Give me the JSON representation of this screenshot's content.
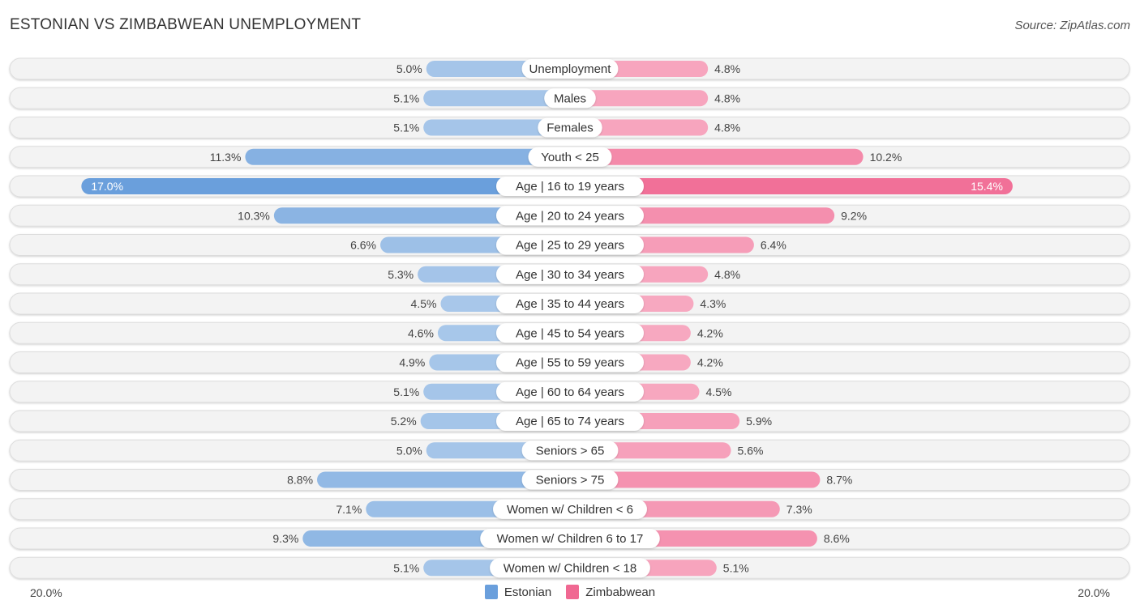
{
  "header": {
    "title": "ESTONIAN VS ZIMBABWEAN UNEMPLOYMENT",
    "source": "Source: ZipAtlas.com"
  },
  "chart_data": {
    "type": "bar",
    "orientation": "horizontal-diverging",
    "title": "ESTONIAN VS ZIMBABWEAN UNEMPLOYMENT",
    "xlabel": "",
    "ylabel": "",
    "xlim": [
      0,
      20.0
    ],
    "axis_tick_labels": {
      "left": "20.0%",
      "right": "20.0%"
    },
    "legend_position": "bottom-center",
    "categories": [
      "Unemployment",
      "Males",
      "Females",
      "Youth < 25",
      "Age | 16 to 19 years",
      "Age | 20 to 24 years",
      "Age | 25 to 29 years",
      "Age | 30 to 34 years",
      "Age | 35 to 44 years",
      "Age | 45 to 54 years",
      "Age | 55 to 59 years",
      "Age | 60 to 64 years",
      "Age | 65 to 74 years",
      "Seniors > 65",
      "Seniors > 75",
      "Women w/ Children < 6",
      "Women w/ Children 6 to 17",
      "Women w/ Children < 18"
    ],
    "series": [
      {
        "name": "Estonian",
        "side": "left",
        "color": "#6a9fdc",
        "color_light": "#a9c8ea",
        "values": [
          5.0,
          5.1,
          5.1,
          11.3,
          17.0,
          10.3,
          6.6,
          5.3,
          4.5,
          4.6,
          4.9,
          5.1,
          5.2,
          5.0,
          8.8,
          7.1,
          9.3,
          5.1
        ],
        "labels": [
          "5.0%",
          "5.1%",
          "5.1%",
          "11.3%",
          "17.0%",
          "10.3%",
          "6.6%",
          "5.3%",
          "4.5%",
          "4.6%",
          "4.9%",
          "5.1%",
          "5.2%",
          "5.0%",
          "8.8%",
          "7.1%",
          "9.3%",
          "5.1%"
        ]
      },
      {
        "name": "Zimbabwean",
        "side": "right",
        "color": "#f06892",
        "color_light": "#f7a8c0",
        "values": [
          4.8,
          4.8,
          4.8,
          10.2,
          15.4,
          9.2,
          6.4,
          4.8,
          4.3,
          4.2,
          4.2,
          4.5,
          5.9,
          5.6,
          8.7,
          7.3,
          8.6,
          5.1
        ],
        "labels": [
          "4.8%",
          "4.8%",
          "4.8%",
          "10.2%",
          "15.4%",
          "9.2%",
          "6.4%",
          "4.8%",
          "4.3%",
          "4.2%",
          "4.2%",
          "4.5%",
          "5.9%",
          "5.6%",
          "8.7%",
          "7.3%",
          "8.6%",
          "5.1%"
        ]
      }
    ]
  },
  "legend": {
    "items": [
      {
        "label": "Estonian",
        "color": "#6a9fdc"
      },
      {
        "label": "Zimbabwean",
        "color": "#f06892"
      }
    ]
  }
}
